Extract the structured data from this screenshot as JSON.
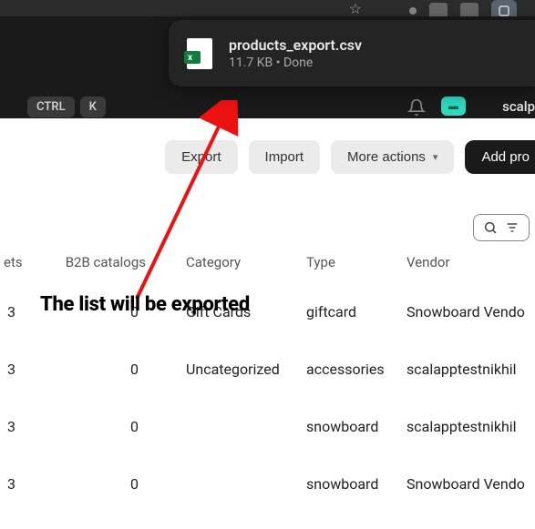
{
  "download": {
    "filename": "products_export.csv",
    "size": "11.7 KB",
    "status": "Done"
  },
  "shortcut": {
    "ctrl": "CTRL",
    "k": "K"
  },
  "topbar": {
    "brand": "scalp"
  },
  "actions": {
    "export": "Export",
    "import": "Import",
    "more": "More actions",
    "add": "Add pro"
  },
  "annotation": "The list will be exported",
  "table": {
    "headers": {
      "ets": "ets",
      "b2b": "B2B catalogs",
      "category": "Category",
      "type": "Type",
      "vendor": "Vendor"
    },
    "rows": [
      {
        "ets": "3",
        "b2b": "0",
        "category": "Gift Cards",
        "type": "giftcard",
        "vendor": "Snowboard Vendo"
      },
      {
        "ets": "3",
        "b2b": "0",
        "category": "Uncategorized",
        "type": "accessories",
        "vendor": "scalapptestnikhil"
      },
      {
        "ets": "3",
        "b2b": "0",
        "category": "",
        "type": "snowboard",
        "vendor": "scalapptestnikhil"
      },
      {
        "ets": "3",
        "b2b": "0",
        "category": "",
        "type": "snowboard",
        "vendor": "Snowboard Vendo"
      }
    ]
  }
}
